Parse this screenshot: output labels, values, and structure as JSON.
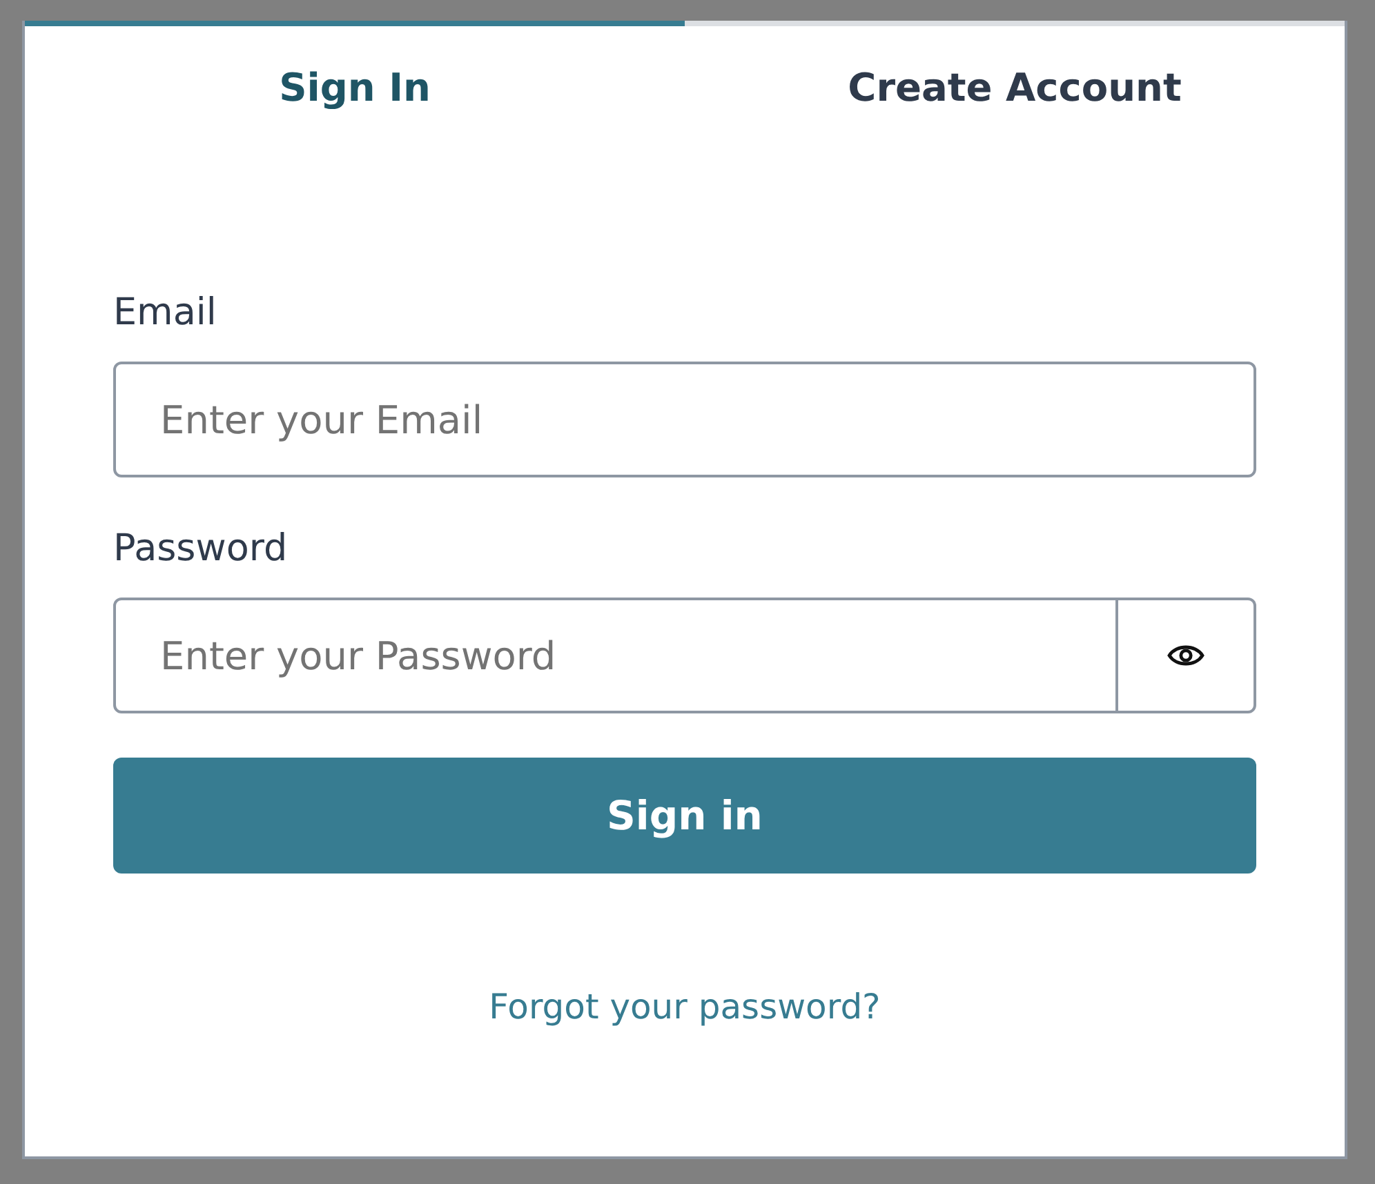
{
  "tabs": [
    {
      "label": "Sign In",
      "selected": true
    },
    {
      "label": "Create Account",
      "selected": false
    }
  ],
  "fields": [
    {
      "label": "Email",
      "placeholder": "Enter your Email",
      "kind": "text"
    },
    {
      "label": "Password",
      "placeholder": "Enter your Password",
      "kind": "password"
    }
  ],
  "submit": {
    "label": "Sign in"
  },
  "forgot_link": {
    "label": "Forgot your password?"
  }
}
